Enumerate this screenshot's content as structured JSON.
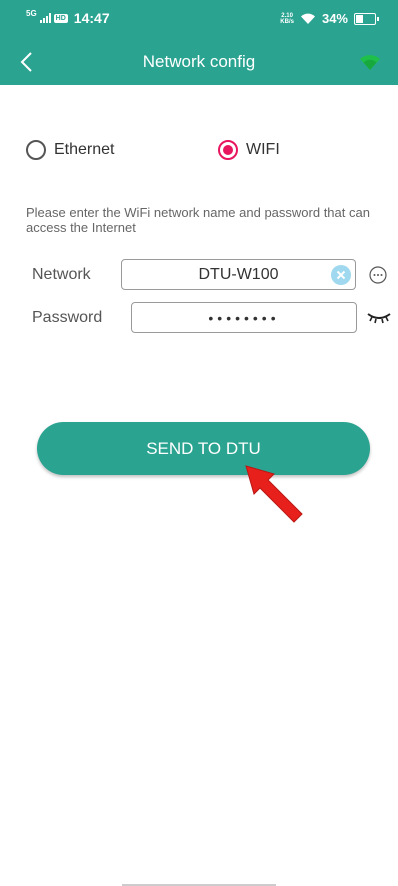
{
  "status_bar": {
    "network": "5G",
    "hd": "HD",
    "time": "14:47",
    "speed_value": "2.10",
    "speed_unit": "KB/s",
    "battery": "34%"
  },
  "nav": {
    "title": "Network config",
    "wifi_icon": "wifi-icon"
  },
  "mode": {
    "options": [
      "Ethernet",
      "WIFI"
    ],
    "selected": "WIFI"
  },
  "form": {
    "hint": "Please enter the WiFi network name and password that can access the Internet",
    "network_label": "Network",
    "network_value": "DTU-W100",
    "password_label": "Password",
    "password_value": "••••••••"
  },
  "actions": {
    "send_label": "SEND TO DTU"
  },
  "colors": {
    "primary": "#2aa391",
    "radio_selected": "#e8155f",
    "wifi_icon": "#1fc04a",
    "annotation_arrow": "#e8201c"
  }
}
